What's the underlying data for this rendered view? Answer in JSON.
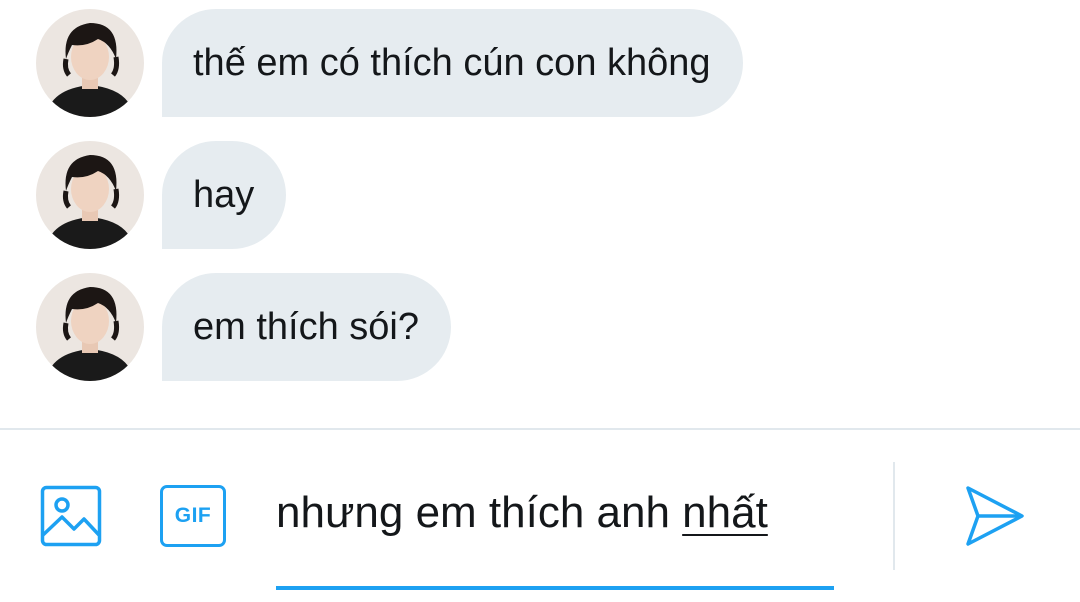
{
  "messages": [
    {
      "text": "thế em có thích cún con không",
      "avatar": "avatar"
    },
    {
      "text": "hay",
      "avatar": "avatar"
    },
    {
      "text": "em thích sói?",
      "avatar": "avatar"
    }
  ],
  "composer": {
    "text_main": "nhưng em thích anh ",
    "text_underlined": "nhất",
    "gif_label": "GIF",
    "icons": {
      "image": "image-icon",
      "gif": "gif-icon",
      "send": "send-icon"
    }
  },
  "colors": {
    "accent": "#1da1f2",
    "bubble": "#e6ecf0",
    "text": "#14171a",
    "divider": "#e1e8ed"
  }
}
